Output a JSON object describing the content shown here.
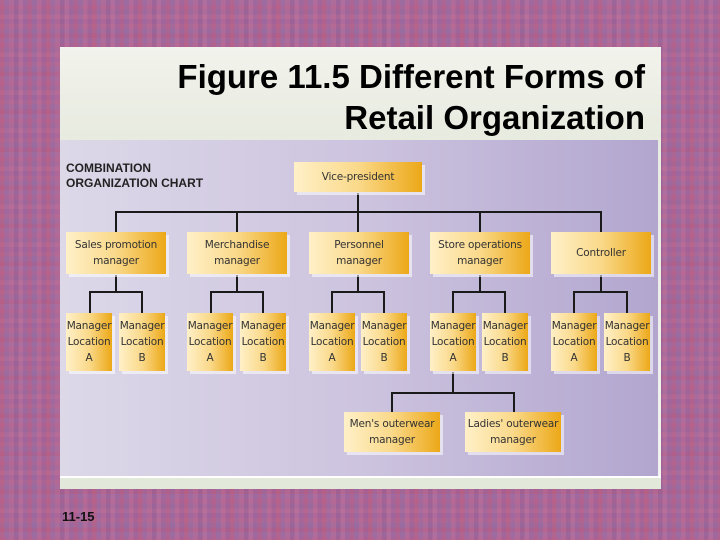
{
  "slide": {
    "title_line1": "Figure 11.5 Different Forms of",
    "title_line2": "Retail Organization",
    "page_number": "11-15"
  },
  "chart": {
    "heading_line1": "COMBINATION",
    "heading_line2": "ORGANIZATION CHART",
    "root": "Vice-president",
    "departments": [
      "Sales promotion\nmanager",
      "Merchandise\nmanager",
      "Personnel\nmanager",
      "Store operations\nmanager",
      "Controller"
    ],
    "location_a": "Manager\nLocation\nA",
    "location_b": "Manager\nLocation\nB",
    "sub_managers": [
      "Men's outerwear\nmanager",
      "Ladies' outerwear\nmanager"
    ]
  },
  "colors": {
    "box_light": "#fff0c8",
    "box_dark": "#eca818",
    "chart_bg": "#cdc4df",
    "line": "#1a1a1a"
  }
}
